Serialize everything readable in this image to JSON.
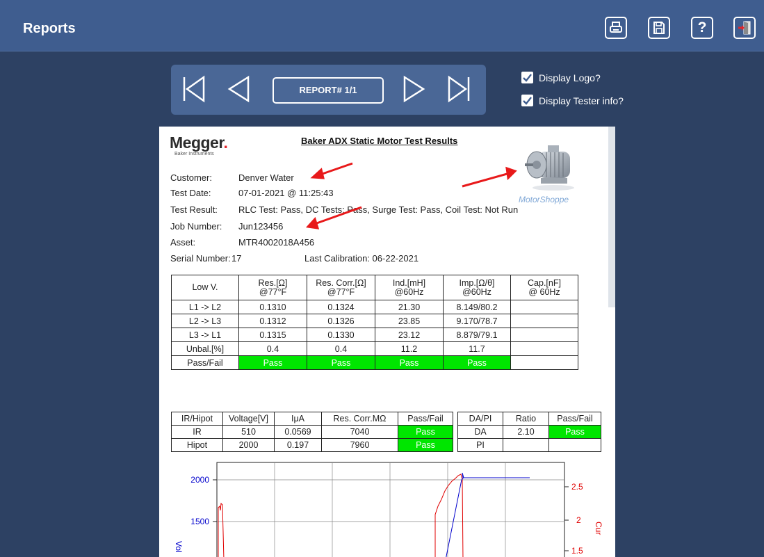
{
  "header": {
    "title": "Reports"
  },
  "toolbar": {
    "icons": [
      "printer-icon",
      "save-icon",
      "help-icon",
      "exit-icon"
    ],
    "help_glyph": "?"
  },
  "nav": {
    "report_label": "REPORT# 1/1"
  },
  "options": {
    "display_logo": {
      "label": "Display Logo?",
      "checked": true
    },
    "display_tester": {
      "label": "Display Tester info?",
      "checked": true
    }
  },
  "report": {
    "logo_text": "Megger",
    "logo_dot": ".",
    "logo_sub": "Baker Instruments",
    "title": "Baker ADX Static Motor Test Results",
    "brand": "MotorShoppe",
    "fields": [
      {
        "key": "Customer:",
        "value": "Denver Water"
      },
      {
        "key": "Test Date:",
        "value": "07-01-2021 @ 11:25:43"
      },
      {
        "key": "Test Result:",
        "value": "RLC Test: Pass, DC Tests: Pass, Surge Test: Pass, Coil Test: Not Run"
      },
      {
        "key": "Job Number:",
        "value": "Jun123456"
      },
      {
        "key": "Asset:",
        "value": "MTR4002018A456"
      }
    ],
    "serial_label": "Serial Number:",
    "serial_value": "17",
    "last_cal": "Last Calibration: 06-22-2021",
    "rlc_table": {
      "headers": [
        [
          "Low V.",
          ""
        ],
        [
          "Res.[Ω]",
          "@77°F"
        ],
        [
          "Res. Corr.[Ω]",
          "@77°F"
        ],
        [
          "Ind.[mH]",
          "@60Hz"
        ],
        [
          "Imp.[Ω/θ]",
          "@60Hz"
        ],
        [
          "Cap.[nF]",
          "@ 60Hz"
        ]
      ],
      "rows": [
        [
          "L1 -> L2",
          "0.1310",
          "0.1324",
          "21.30",
          "8.149/80.2",
          ""
        ],
        [
          "L2 -> L3",
          "0.1312",
          "0.1326",
          "23.85",
          "9.170/78.7",
          ""
        ],
        [
          "L3 -> L1",
          "0.1315",
          "0.1330",
          "23.12",
          "8.879/79.1",
          ""
        ],
        [
          "Unbal.[%]",
          "0.4",
          "0.4",
          "11.2",
          "11.7",
          ""
        ]
      ],
      "passfail_label": "Pass/Fail",
      "passfail": [
        "Pass",
        "Pass",
        "Pass",
        "Pass"
      ]
    },
    "ir_table": {
      "headers": [
        "IR/Hipot",
        "Voltage[V]",
        "IμA",
        "Res. Corr.MΩ",
        "Pass/Fail"
      ],
      "rows": [
        [
          "IR",
          "510",
          "0.0569",
          "7040",
          "Pass"
        ],
        [
          "Hipot",
          "2000",
          "0.197",
          "7960",
          "Pass"
        ]
      ]
    },
    "dapi_table": {
      "headers": [
        "DA/PI",
        "Ratio",
        "Pass/Fail"
      ],
      "rows": [
        [
          "DA",
          "2.10",
          "Pass"
        ],
        [
          "PI",
          "",
          ""
        ]
      ]
    }
  },
  "chart_data": {
    "type": "line",
    "title": "",
    "ylabel": "Vol",
    "y2label": "Cur",
    "y_ticks": [
      "2000",
      "1500"
    ],
    "y2_ticks": [
      "2.5",
      "2",
      "1.5"
    ],
    "colors": {
      "voltage": "#0000cc",
      "current": "#e00000"
    }
  }
}
